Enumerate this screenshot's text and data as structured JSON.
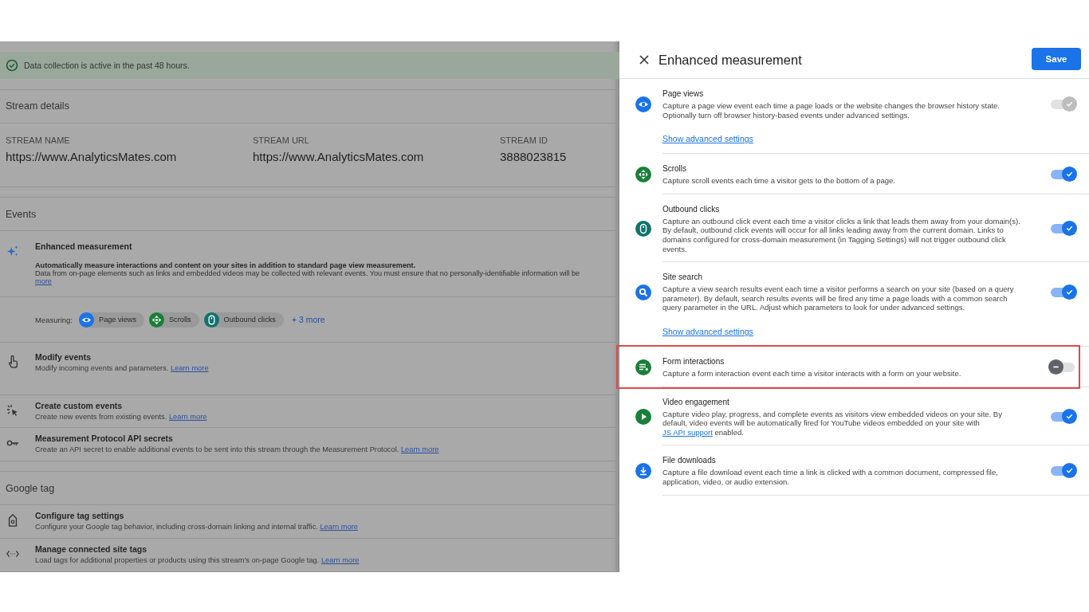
{
  "background_page": {
    "banner": {
      "text": "Data collection is active in the past 48 hours."
    },
    "stream_details": {
      "title": "Stream details",
      "fields": [
        {
          "label": "STREAM NAME",
          "value": "https://www.AnalyticsMates.com"
        },
        {
          "label": "STREAM URL",
          "value": "https://www.AnalyticsMates.com"
        },
        {
          "label": "STREAM ID",
          "value": "3888023815"
        }
      ]
    },
    "events": {
      "title": "Events",
      "enhanced": {
        "title": "Enhanced measurement",
        "line_1": "Automatically measure interactions and content on your sites in addition to standard page view measurement.",
        "line_2": "Data from on-page elements such as links and embedded videos may be collected with relevant events. You must ensure that no personally-identifiable information will be",
        "link": "more",
        "measuring_label": "Measuring:",
        "chips": [
          {
            "kind": "page_views",
            "label": "Page views",
            "color": "#1a73e8"
          },
          {
            "kind": "scrolls",
            "label": "Scrolls",
            "color": "#188038"
          },
          {
            "kind": "outbound_clicks",
            "label": "Outbound clicks",
            "color": "#12736b"
          }
        ],
        "more": "+ 3 more"
      },
      "items": [
        {
          "kind": "modify",
          "title": "Modify events",
          "description": "Modify incoming events and parameters.",
          "link": "Learn more"
        },
        {
          "kind": "custom",
          "title": "Create custom events",
          "description": "Create new events from existing events.",
          "link": "Learn more"
        },
        {
          "kind": "secrets",
          "title": "Measurement Protocol API secrets",
          "description": "Create an API secret to enable additional events to be sent into this stream through the Measurement Protocol.",
          "link": "Learn more"
        }
      ]
    },
    "google_tag": {
      "title": "Google tag",
      "items": [
        {
          "kind": "tag",
          "title": "Configure tag settings",
          "description": "Configure your Google tag behavior, including cross-domain linking and internal traffic.",
          "link": "Learn more"
        },
        {
          "kind": "connected",
          "title": "Manage connected site tags",
          "description": "Load tags for additional properties or products using this stream's on-page Google tag.",
          "link": "Learn more"
        }
      ]
    }
  },
  "panel": {
    "title": "Enhanced measurement",
    "save": "Save",
    "settings": [
      {
        "kind": "page_views",
        "color": "#1a73e8",
        "title": "Page views",
        "description": "Capture a page view event each time a page loads or the website changes the browser history state. Optionally turn off browser history-based events under advanced settings.",
        "advanced_link": "Show advanced settings",
        "on": true,
        "disabled": true,
        "highlighted": false
      },
      {
        "kind": "scrolls",
        "color": "#188038",
        "title": "Scrolls",
        "description": "Capture scroll events each time a visitor gets to the bottom of a page.",
        "on": true,
        "disabled": false,
        "highlighted": false
      },
      {
        "kind": "outbound_clicks",
        "color": "#12736b",
        "title": "Outbound clicks",
        "description": "Capture an outbound click event each time a visitor clicks a link that leads them away from your domain(s). By default, outbound click events will occur for all links leading away from the current domain. Links to domains configured for cross-domain measurement (in Tagging Settings) will not trigger outbound click events.",
        "on": true,
        "disabled": false,
        "highlighted": false
      },
      {
        "kind": "site_search",
        "color": "#1a73e8",
        "title": "Site search",
        "description": "Capture a view search results event each time a visitor performs a search on your site (based on a query parameter). By default, search results events will be fired any time a page loads with a common search query parameter in the URL. Adjust which parameters to look for under advanced settings.",
        "advanced_link": "Show advanced settings",
        "on": true,
        "disabled": false,
        "highlighted": false
      },
      {
        "kind": "form_interactions",
        "color": "#188038",
        "title": "Form interactions",
        "description": "Capture a form interaction event each time a visitor interacts with a form on your website.",
        "on": false,
        "disabled": false,
        "highlighted": true
      },
      {
        "kind": "video_engagement",
        "color": "#188038",
        "title": "Video engagement",
        "description": "Capture video play, progress, and complete events as visitors view embedded videos on your site. By default, video events will be automatically fired for YouTube videos embedded on your site with",
        "link": "JS API support",
        "description_end": " enabled.",
        "on": true,
        "disabled": false,
        "highlighted": false
      },
      {
        "kind": "file_downloads",
        "color": "#1a73e8",
        "title": "File downloads",
        "description": "Capture a file download event each time a link is clicked with a common document, compressed file, application, video, or audio extension.",
        "on": true,
        "disabled": false,
        "highlighted": false
      }
    ]
  }
}
